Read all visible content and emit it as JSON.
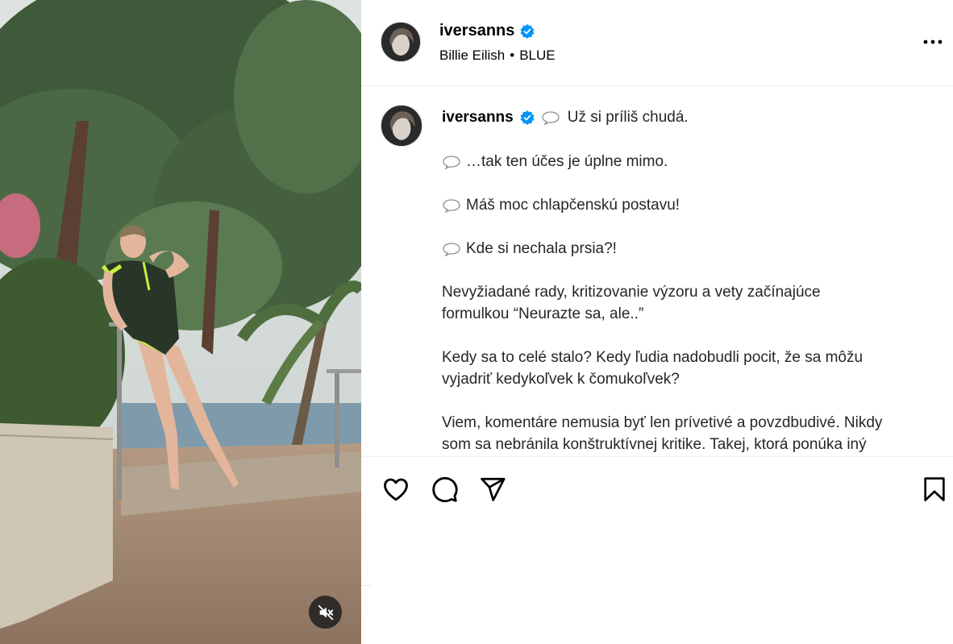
{
  "post": {
    "username": "iversanns",
    "verified": true,
    "audio": {
      "artist": "Billie Eilish",
      "separator": "•",
      "track": "BLUE"
    }
  },
  "caption": {
    "username": "iversanns",
    "lines": [
      "Už si príliš chudá.",
      "…tak ten účes je úplne mimo.",
      "Máš moc chlapčenskú postavu!",
      "Kde si nechala prsia?!",
      "Nevyžiadané rady, kritizovanie výzoru a vety začínajúce",
      "formulkou “Neurazte sa, ale..”",
      "Kedy sa to celé stalo? Kedy ľudia nadobudli pocit, že sa môžu",
      "vyjadriť kedykoľvek k čomukoľvek?",
      "Viem, komentáre nemusia byť len prívetivé a povzdbudivé. Nikdy",
      "som sa nebránila konštruktívnej kritike. Takej, ktorá ponúka iný"
    ]
  },
  "icons": {
    "verified": "verified-badge-icon",
    "more": "more-options-icon",
    "speech": "speech-bubble-icon",
    "like": "heart-icon",
    "comment": "comment-icon",
    "share": "send-icon",
    "save": "bookmark-icon",
    "mute": "muted-speaker-icon"
  },
  "colors": {
    "verified": "#0095f6",
    "text": "#262626",
    "border": "#efefef"
  }
}
